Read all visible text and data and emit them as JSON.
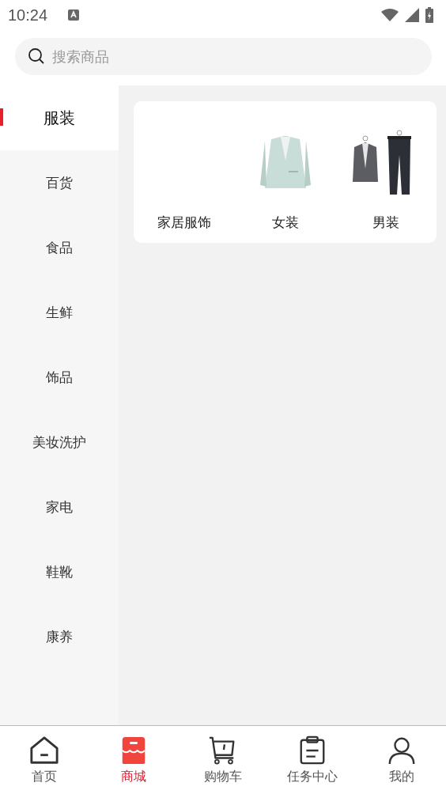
{
  "status_bar": {
    "time": "10:24"
  },
  "search": {
    "placeholder": "搜索商品"
  },
  "sidebar": {
    "items": [
      {
        "label": "服装",
        "selected": true
      },
      {
        "label": "百货",
        "selected": false
      },
      {
        "label": "食品",
        "selected": false
      },
      {
        "label": "生鲜",
        "selected": false
      },
      {
        "label": "饰品",
        "selected": false
      },
      {
        "label": "美妆洗护",
        "selected": false
      },
      {
        "label": "家电",
        "selected": false
      },
      {
        "label": "鞋靴",
        "selected": false
      },
      {
        "label": "康养",
        "selected": false
      }
    ]
  },
  "subcategories": [
    {
      "label": "家居服饰"
    },
    {
      "label": "女装",
      "kind": "picture"
    },
    {
      "label": "男装",
      "kind": "picture"
    }
  ],
  "tab_bar": [
    {
      "label": "首页",
      "kind": "home",
      "selected": false
    },
    {
      "label": "商城",
      "kind": "store",
      "selected": true
    },
    {
      "label": "购物车",
      "kind": "cart",
      "selected": false
    },
    {
      "label": "任务中心",
      "kind": "task",
      "selected": false
    },
    {
      "label": "我的",
      "kind": "user",
      "selected": false
    }
  ]
}
